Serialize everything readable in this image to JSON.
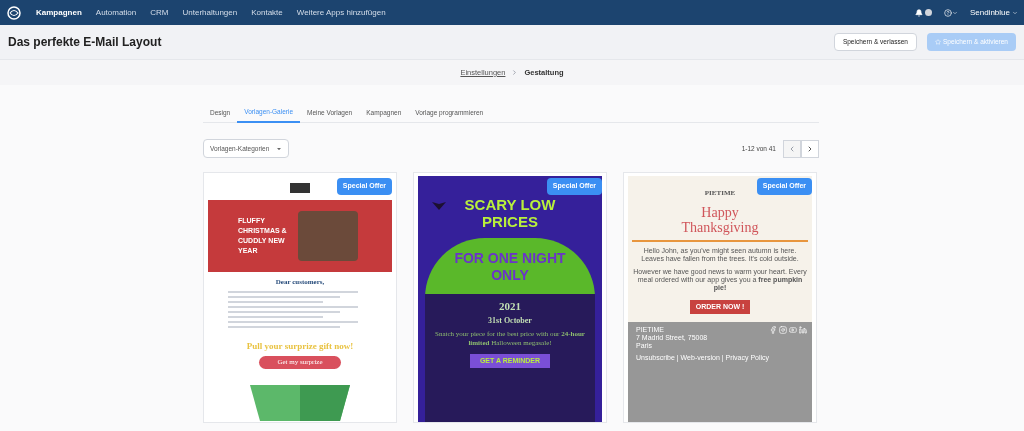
{
  "nav": {
    "items": [
      {
        "label": "Kampagnen",
        "selected": true
      },
      {
        "label": "Automation",
        "selected": false
      },
      {
        "label": "CRM",
        "selected": false
      },
      {
        "label": "Unterhaltungen",
        "selected": false
      },
      {
        "label": "Kontakte",
        "selected": false
      },
      {
        "label": "Weitere Apps hinzufügen",
        "selected": false
      }
    ],
    "account": "Sendinblue"
  },
  "header": {
    "title": "Das perfekte E-Mail Layout",
    "buttons": [
      {
        "label": "Speichern & verlassen",
        "disabled": false
      },
      {
        "label": "Speichern & aktivieren",
        "disabled": true
      }
    ]
  },
  "breadcrumb": [
    {
      "label": "Einstellungen",
      "current": false
    },
    {
      "label": "Gestaltung",
      "current": true
    }
  ],
  "tabs": [
    {
      "label": "Design",
      "selected": false
    },
    {
      "label": "Vorlagen-Galerie",
      "selected": true
    },
    {
      "label": "Meine Vorlagen",
      "selected": false
    },
    {
      "label": "Kampagnen",
      "selected": false
    },
    {
      "label": "Vorlage programmieren",
      "selected": false
    }
  ],
  "filter": {
    "label": "Vorlagen-Kategorien"
  },
  "pagination": {
    "range": "1-12 von 41"
  },
  "templates": [
    {
      "kind": "christmas",
      "badge": "Special Offer",
      "banner": "FLUFFY CHRISTMAS & CUDDLY NEW YEAR",
      "greeting": "Dear customers,",
      "headline": "Pull your surprize gift now!",
      "button": "Get my surprize"
    },
    {
      "kind": "halloween",
      "badge": "Special Offer",
      "headline": "SCARY LOW PRICES",
      "subhead": "FOR ONE NIGHT ONLY",
      "year": "2021",
      "date": "31st October",
      "text": "Snatch your piece for the best price with our **24-hour limited** Halloween megasale!",
      "button": "GET A REMINDER"
    },
    {
      "kind": "thanksgiving",
      "badge": "Special Offer",
      "brand": "PIETIME",
      "headline": "Happy Thanksgiving",
      "paragraphs": [
        "Hello John, as you've might seen autumn is here. Leaves have fallen from the trees. It's cold outside.",
        "However we have good news to warm your heart. Every meal ordered with our app gives you a **free pumpkin pie!**"
      ],
      "button": "ORDER NOW !",
      "footer": {
        "address": [
          "PIETIME",
          "7 Madrid Street, 75008",
          "Paris"
        ],
        "links": "Unsubscribe | Web-version | Privacy Policy"
      }
    }
  ]
}
